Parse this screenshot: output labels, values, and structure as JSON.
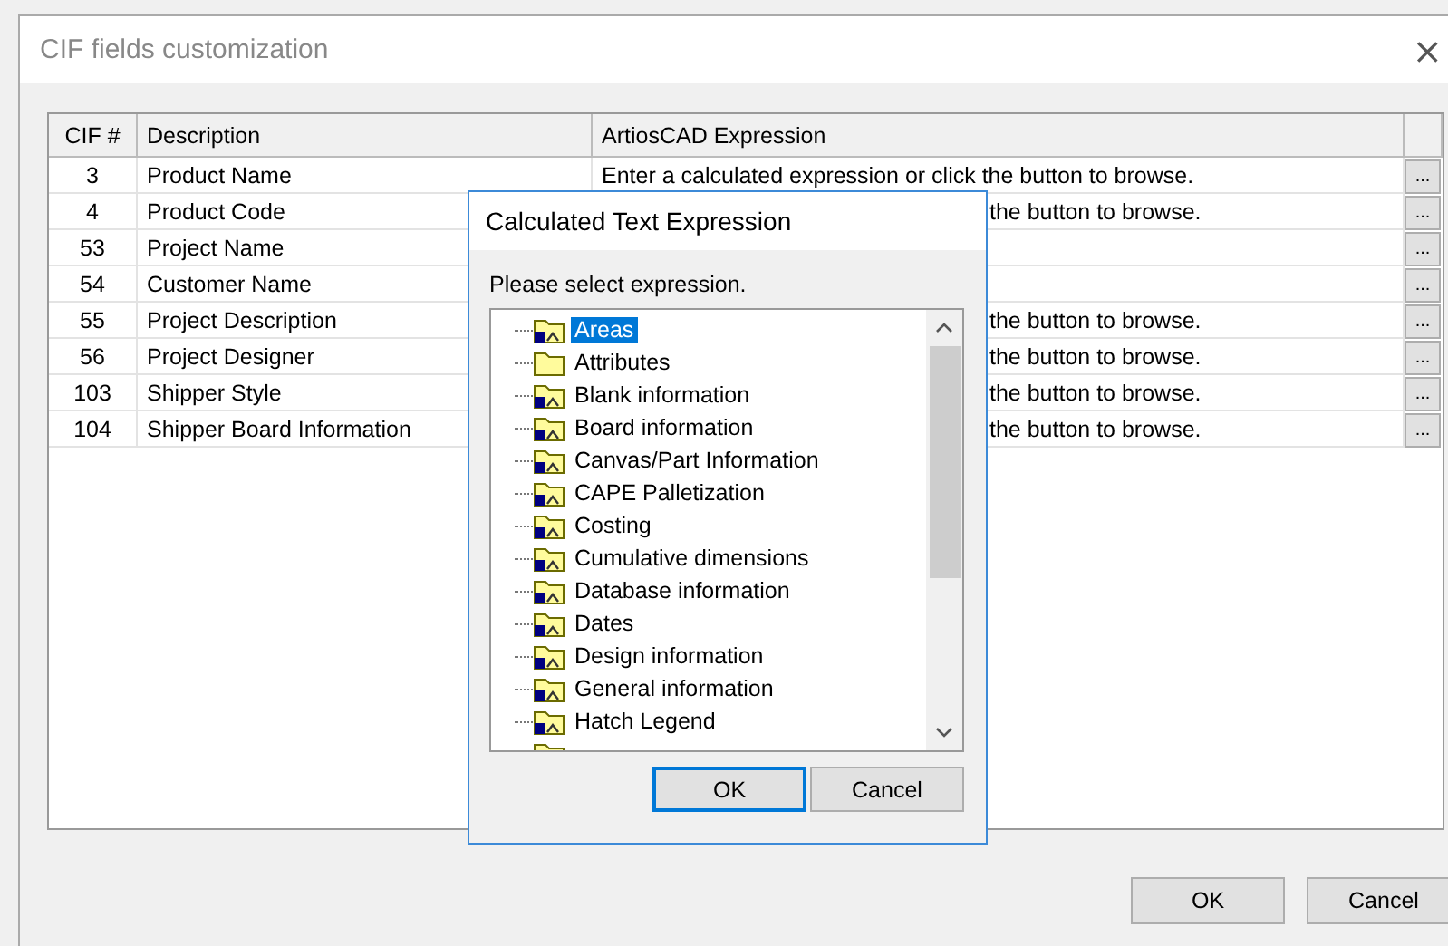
{
  "window": {
    "title": "CIF fields customization",
    "close": "×"
  },
  "table": {
    "columns": [
      "CIF #",
      "Description",
      "ArtiosCAD Expression"
    ],
    "rows": [
      {
        "cif": "3",
        "description": "Product Name",
        "expression": "Enter a calculated expression or click the button to browse.",
        "covered": false,
        "button": "..."
      },
      {
        "cif": "4",
        "description": "Product Code",
        "expression": "the button to browse.",
        "covered": true,
        "button": "..."
      },
      {
        "cif": "53",
        "description": "Project Name",
        "button": "..."
      },
      {
        "cif": "54",
        "description": "Customer Name",
        "button": "..."
      },
      {
        "cif": "55",
        "description": "Project Description",
        "expression": "the button to browse.",
        "covered": true,
        "button": "..."
      },
      {
        "cif": "56",
        "description": "Project Designer",
        "expression": "the button to browse.",
        "covered": true,
        "button": "..."
      },
      {
        "cif": "103",
        "description": "Shipper Style",
        "expression": "the button to browse.",
        "covered": true,
        "button": "..."
      },
      {
        "cif": "104",
        "description": "Shipper Board Information",
        "expression": "the button to browse.",
        "covered": true,
        "button": "..."
      }
    ]
  },
  "dialog": {
    "title": "Calculated Text Expression",
    "prompt": "Please select expression.",
    "tree": [
      {
        "label": "Areas",
        "kind": "expression",
        "selected": true
      },
      {
        "label": "Attributes",
        "kind": "plain",
        "selected": false
      },
      {
        "label": "Blank information",
        "kind": "expression",
        "selected": false
      },
      {
        "label": "Board information",
        "kind": "expression",
        "selected": false
      },
      {
        "label": "Canvas/Part Information",
        "kind": "expression",
        "selected": false
      },
      {
        "label": "CAPE Palletization",
        "kind": "expression",
        "selected": false
      },
      {
        "label": "Costing",
        "kind": "expression",
        "selected": false
      },
      {
        "label": "Cumulative dimensions",
        "kind": "expression",
        "selected": false
      },
      {
        "label": "Database information",
        "kind": "expression",
        "selected": false
      },
      {
        "label": "Dates",
        "kind": "expression",
        "selected": false
      },
      {
        "label": "Design information",
        "kind": "expression",
        "selected": false
      },
      {
        "label": "General information",
        "kind": "expression",
        "selected": false
      },
      {
        "label": "Hatch Legend",
        "kind": "expression",
        "selected": false
      }
    ],
    "buttons": [
      "OK",
      "Cancel"
    ]
  },
  "buttons": [
    "OK",
    "Cancel"
  ]
}
